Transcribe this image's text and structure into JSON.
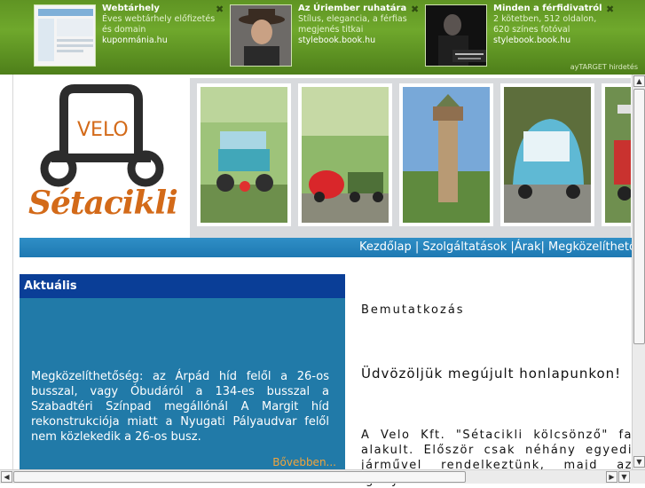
{
  "ads": [
    {
      "title": "Webtárhely",
      "desc": "Éves webtárhely előfizetés és domain",
      "domain": "kuponmánia.hu"
    },
    {
      "title": "Az Úriember ruhatára",
      "desc": "Stílus, elegancia, a férfias megjenés titkai",
      "domain": "stylebook.book.hu"
    },
    {
      "title": "Minden a férfidivatról",
      "desc": "2 kötetben, 512 oldalon, 620 színes fotóval",
      "domain": "stylebook.book.hu"
    }
  ],
  "ad_credit": "ayTARGET hirdetés",
  "ad_close": "✖",
  "logo": {
    "velo": "VELO",
    "name": "Sétacikli"
  },
  "nav": {
    "text": "Kezdőlap | Szolgáltatások |Árak| Megközelíthetőség"
  },
  "aktualis": {
    "title": "Aktuális",
    "body": "Megközelíthetőség: az Árpád híd felől a 26-os busszal, vagy Óbudáról a 134-es busszal a Szabadtéri Színpad megállónál A Margit híd rekonstrukciója miatt a Nyugati Pályaudvar felől nem közlekedik a 26-os busz.",
    "more": "Bővebben..."
  },
  "content": {
    "heading": "Bemutatkozás",
    "welcome": "Üdvözöljük megújult honlapunkon!",
    "para": "A Velo Kft. \"Sétacikli kölcsönző\" fa alakult. Először csak néhány egyedi járművel rendelkeztünk, majd az igény"
  },
  "colors": {
    "ad_green": "#6fa82c",
    "nav_blue": "#2f8fc6",
    "box_blue": "#217aa8",
    "box_header": "#0a3e97",
    "logo_orange": "#d36a19",
    "more_orange": "#f2a53c"
  }
}
